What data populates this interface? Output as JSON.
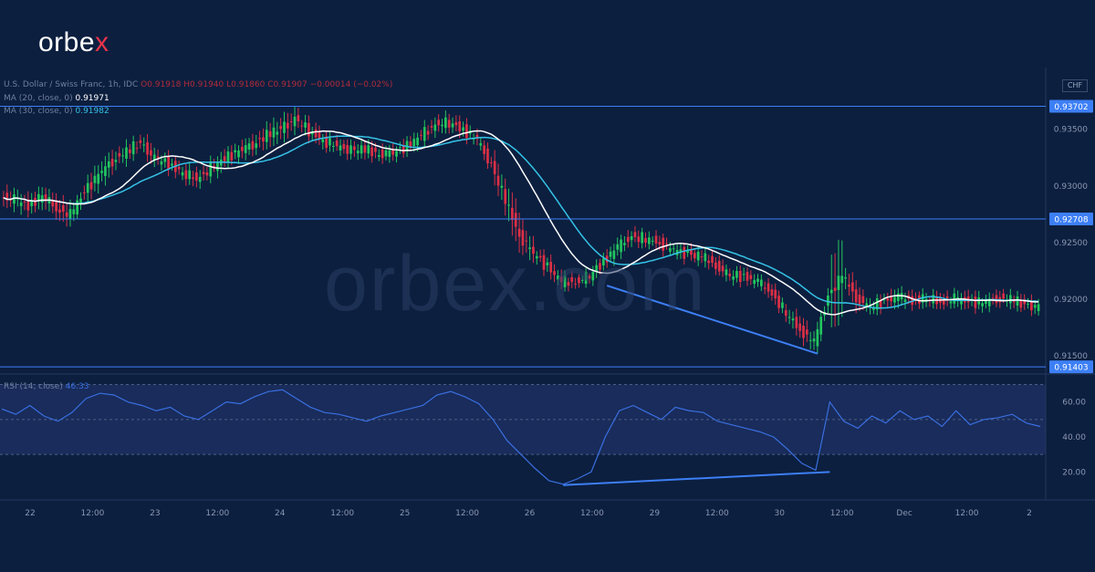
{
  "brand": {
    "logo_text": "orbe",
    "logo_x": "x",
    "watermark": "orbex.com"
  },
  "legend": {
    "symbol": "U.S. Dollar / Swiss Franc, 1h, IDC",
    "ohlc": "O0.91918  H0.91940  L0.91860  C0.91907  −0.00014 (−0.02%)",
    "ma20_label": "MA (20, close, 0)",
    "ma20_value": "0.91971",
    "ma30_label": "MA (30, close, 0)",
    "ma30_value": "0.91982",
    "rsi_label": "RSI (14, close)",
    "rsi_value": "46.33"
  },
  "currency_badge": "CHF",
  "colors": {
    "background": "#0c1f3f",
    "up": "#22c55e",
    "down": "#dc2f45",
    "ma20": "#ffffff",
    "ma30": "#35c3e6",
    "level": "#3d7ff5",
    "rsi": "#3a6fe0",
    "rsi_band": "#1d3266"
  },
  "chart_data": {
    "type": "candlestick",
    "symbol": "USD/CHF",
    "timeframe": "1h",
    "price_axis": {
      "ticks": [
        "0.93500",
        "0.93000",
        "0.92500",
        "0.92000",
        "0.91500"
      ]
    },
    "horizontal_levels": [
      "0.93702",
      "0.92708",
      "0.91403"
    ],
    "time_axis": {
      "ticks": [
        "22",
        "12:00",
        "23",
        "12:00",
        "24",
        "12:00",
        "25",
        "12:00",
        "26",
        "12:00",
        "29",
        "12:00",
        "30",
        "12:00",
        "Dec",
        "12:00",
        "2"
      ]
    },
    "price_path": [
      [
        0.9298,
        0.9282
      ],
      [
        0.9296,
        0.928
      ],
      [
        0.929,
        0.9275
      ],
      [
        0.93,
        0.9284
      ],
      [
        0.929,
        0.927
      ],
      [
        0.928,
        0.9268
      ],
      [
        0.9305,
        0.9285
      ],
      [
        0.932,
        0.93
      ],
      [
        0.933,
        0.9315
      ],
      [
        0.9336,
        0.9325
      ],
      [
        0.9345,
        0.933
      ],
      [
        0.933,
        0.9318
      ],
      [
        0.9325,
        0.9315
      ],
      [
        0.9318,
        0.9305
      ],
      [
        0.9312,
        0.93
      ],
      [
        0.9322,
        0.9308
      ],
      [
        0.933,
        0.9318
      ],
      [
        0.9338,
        0.9325
      ],
      [
        0.9345,
        0.9328
      ],
      [
        0.9355,
        0.9335
      ],
      [
        0.936,
        0.934
      ],
      [
        0.9366,
        0.9352
      ],
      [
        0.9355,
        0.9343
      ],
      [
        0.9345,
        0.9335
      ],
      [
        0.934,
        0.933
      ],
      [
        0.9337,
        0.9325
      ],
      [
        0.9338,
        0.9327
      ],
      [
        0.9333,
        0.9323
      ],
      [
        0.9335,
        0.9325
      ],
      [
        0.934,
        0.933
      ],
      [
        0.935,
        0.9338
      ],
      [
        0.936,
        0.9348
      ],
      [
        0.9362,
        0.935
      ],
      [
        0.9355,
        0.9345
      ],
      [
        0.9345,
        0.9335
      ],
      [
        0.933,
        0.9305
      ],
      [
        0.9305,
        0.927
      ],
      [
        0.9268,
        0.9245
      ],
      [
        0.9246,
        0.9235
      ],
      [
        0.9235,
        0.9222
      ],
      [
        0.922,
        0.921
      ],
      [
        0.9218,
        0.9212
      ],
      [
        0.9226,
        0.9216
      ],
      [
        0.924,
        0.9228
      ],
      [
        0.9252,
        0.924
      ],
      [
        0.926,
        0.925
      ],
      [
        0.9258,
        0.9248
      ],
      [
        0.9255,
        0.9245
      ],
      [
        0.9248,
        0.9238
      ],
      [
        0.9245,
        0.9235
      ],
      [
        0.9243,
        0.9232
      ],
      [
        0.9235,
        0.9225
      ],
      [
        0.9226,
        0.9216
      ],
      [
        0.9225,
        0.9216
      ],
      [
        0.922,
        0.921
      ],
      [
        0.921,
        0.92
      ],
      [
        0.9195,
        0.918
      ],
      [
        0.9182,
        0.9165
      ],
      [
        0.9168,
        0.9155
      ],
      [
        0.9245,
        0.916
      ],
      [
        0.9232,
        0.921
      ],
      [
        0.9208,
        0.9195
      ],
      [
        0.9198,
        0.9188
      ],
      [
        0.9205,
        0.9192
      ],
      [
        0.9208,
        0.9196
      ],
      [
        0.9204,
        0.9194
      ],
      [
        0.9206,
        0.9196
      ],
      [
        0.9203,
        0.9193
      ],
      [
        0.9206,
        0.9194
      ],
      [
        0.9204,
        0.9193
      ],
      [
        0.9202,
        0.9192
      ],
      [
        0.9206,
        0.9196
      ],
      [
        0.9205,
        0.9195
      ],
      [
        0.92,
        0.919
      ],
      [
        0.9198,
        0.9188
      ]
    ],
    "rsi": {
      "period": 14,
      "levels": [
        70,
        50,
        30
      ],
      "value": 46.33,
      "ticks": [
        "60.00",
        "40.00",
        "20.00"
      ],
      "values": [
        56,
        53,
        58,
        52,
        49,
        54,
        62,
        65,
        64,
        60,
        58,
        55,
        57,
        52,
        50,
        55,
        60,
        59,
        63,
        66,
        67,
        62,
        57,
        54,
        53,
        51,
        49,
        52,
        54,
        56,
        58,
        64,
        66,
        63,
        59,
        50,
        38,
        30,
        22,
        15,
        13,
        16,
        20,
        40,
        55,
        58,
        54,
        50,
        57,
        55,
        54,
        49,
        47,
        45,
        43,
        40,
        33,
        25,
        21,
        60,
        49,
        45,
        52,
        48,
        55,
        50,
        52,
        46,
        55,
        47,
        50,
        51,
        53,
        48,
        46
      ]
    },
    "divergence_lines": [
      {
        "pane": "price",
        "from": {
          "index": 43,
          "price": 0.9212
        },
        "to": {
          "index": 58,
          "price": 0.9152
        }
      },
      {
        "pane": "rsi",
        "from": {
          "index": 40,
          "rsi": 12.5
        },
        "to": {
          "index": 59,
          "rsi": 20
        }
      }
    ]
  }
}
